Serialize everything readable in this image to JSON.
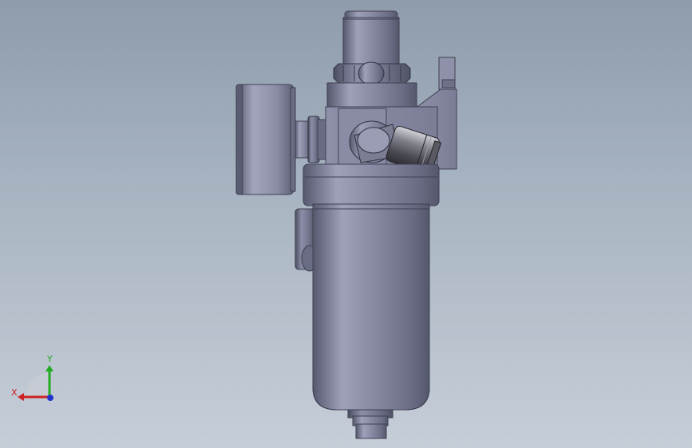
{
  "viewport": {
    "background_top": "#8e9cab",
    "background_bottom": "#c6ced8"
  },
  "model": {
    "body_color": "#7d7f9a",
    "highlight_color": "#b5b7cc",
    "shadow_color": "#4a4c60",
    "fitting_color": "#5c5c66",
    "fitting_highlight": "#c8c8d0"
  },
  "triad": {
    "x_label": "X",
    "y_label": "Y",
    "x_color": "#cc2222",
    "y_color": "#22aa22",
    "z_color": "#2233cc"
  }
}
